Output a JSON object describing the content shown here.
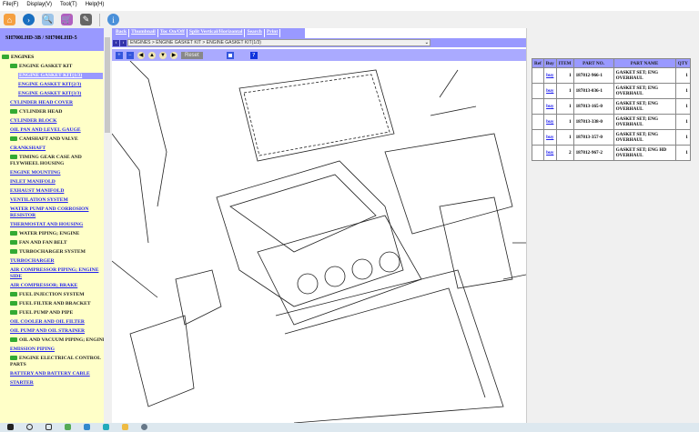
{
  "menu": [
    "File(F)",
    "Display(V)",
    "Tool(T)",
    "Help(H)"
  ],
  "toolbar_icons": [
    "home-icon",
    "forward-icon",
    "search-doc-icon",
    "cart-icon",
    "edit-icon",
    "info-icon"
  ],
  "left": {
    "title": "SH700LHD-3B / SH700LHD-5",
    "tree": [
      {
        "label": "ENGINES",
        "type": "root"
      },
      {
        "label": "ENGINE GASKET KIT",
        "type": "folder"
      },
      {
        "label": "ENGINE GASKET KIT(1/3)",
        "type": "selected"
      },
      {
        "label": "ENGINE GASKET KIT(2/3)",
        "type": "sub"
      },
      {
        "label": "ENGINE GASKET KIT(3/3)",
        "type": "sub"
      },
      {
        "label": "CYLINDER HEAD COVER",
        "type": "link"
      },
      {
        "label": "CYLINDER HEAD",
        "type": "folder"
      },
      {
        "label": "CYLINDER BLOCK",
        "type": "link"
      },
      {
        "label": "OIL PAN AND LEVEL GAUGE",
        "type": "link"
      },
      {
        "label": "CAMSHAFT AND VALVE",
        "type": "folder"
      },
      {
        "label": "CRANKSHAFT",
        "type": "link"
      },
      {
        "label": "TIMING GEAR CASE AND FLYWHEEL HOUSING",
        "type": "folder"
      },
      {
        "label": "ENGINE MOUNTING",
        "type": "link"
      },
      {
        "label": "INLET MANIFOLD",
        "type": "link"
      },
      {
        "label": "EXHAUST MANIFOLD",
        "type": "link"
      },
      {
        "label": "VENTILATION SYSTEM",
        "type": "link"
      },
      {
        "label": "WATER PUMP AND CORROSION RESISTOR",
        "type": "link"
      },
      {
        "label": "THERMOSTAT AND HOUSING",
        "type": "link"
      },
      {
        "label": "WATER PIPING; ENGINE",
        "type": "folder"
      },
      {
        "label": "FAN AND FAN BELT",
        "type": "folder"
      },
      {
        "label": "TURBOCHARGER SYSTEM",
        "type": "folder"
      },
      {
        "label": "TURBOCHARGER",
        "type": "link"
      },
      {
        "label": "AIR COMPRESSOR PIPING; ENGINE SIDE",
        "type": "link"
      },
      {
        "label": "AIR COMPRESSOR; BRAKE",
        "type": "link"
      },
      {
        "label": "FUEL INJECTION SYSTEM",
        "type": "folder"
      },
      {
        "label": "FUEL FILTER AND BRACKET",
        "type": "folder"
      },
      {
        "label": "FUEL PUMP AND PIPE",
        "type": "folder"
      },
      {
        "label": "OIL COOLER AND OIL FILTER",
        "type": "link"
      },
      {
        "label": "OIL PUMP AND OIL STRAINER",
        "type": "link"
      },
      {
        "label": "OIL AND VACUUM PIPING; ENGINE",
        "type": "folder"
      },
      {
        "label": "EMISSION PIPING",
        "type": "link"
      },
      {
        "label": "ENGINE ELECTRICAL CONTROL PARTS",
        "type": "folder"
      },
      {
        "label": "BATTERY AND BATTERY CABLE",
        "type": "link"
      },
      {
        "label": "STARTER",
        "type": "link"
      }
    ]
  },
  "main": {
    "links": [
      "Back",
      "Thumbnail",
      "Toc On/Off",
      "Split Vertical/Horizontal",
      "Search",
      "Print"
    ],
    "breadcrumb": "ENGINES > ENGINE GASKET KIT > ENGINE GASKET KIT(1/3)",
    "reset": "Reset",
    "help": "?"
  },
  "parts": {
    "headers": [
      "Ref",
      "Buy",
      "ITEM",
      "PART NO.",
      "PART NAME",
      "QTY"
    ],
    "rows": [
      {
        "ref": "",
        "buy": "buy",
        "item": "1",
        "part_no": "187812-966-1",
        "name": "GASKET SET; ENG OVERHAUL",
        "qty": "1"
      },
      {
        "ref": "",
        "buy": "buy",
        "item": "1",
        "part_no": "187813-036-1",
        "name": "GASKET SET; ENG OVERHAUL",
        "qty": "1"
      },
      {
        "ref": "",
        "buy": "buy",
        "item": "1",
        "part_no": "187813-165-0",
        "name": "GASKET SET; ENG OVERHAUL",
        "qty": "1"
      },
      {
        "ref": "",
        "buy": "buy",
        "item": "1",
        "part_no": "187813-338-0",
        "name": "GASKET SET; ENG OVERHAUL",
        "qty": "1"
      },
      {
        "ref": "",
        "buy": "buy",
        "item": "1",
        "part_no": "187813-357-0",
        "name": "GASKET SET; ENG OVERHAUL",
        "qty": "1"
      },
      {
        "ref": "",
        "buy": "buy",
        "item": "2",
        "part_no": "187812-967-2",
        "name": "GASKET SET; ENG HD OVERHAUL",
        "qty": "1"
      }
    ]
  }
}
